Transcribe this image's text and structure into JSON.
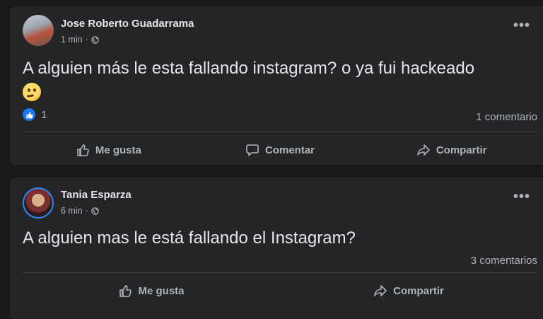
{
  "posts": [
    {
      "author": "Jose Roberto Guadarrama",
      "time": "1 min",
      "privacy_icon": "globe-icon",
      "text": "A alguien más le esta fallando instagram? o ya fui hackeado",
      "emoji": "thinking-face",
      "reaction_icon": "like-icon",
      "reaction_count": "1",
      "comments": "1 comentario",
      "actions": [
        "Me gusta",
        "Comentar",
        "Compartir"
      ]
    },
    {
      "author": "Tania Esparza",
      "time": "6 min",
      "privacy_icon": "globe-icon",
      "text": "A alguien mas le está fallando el Instagram?",
      "comments": "3 comentarios",
      "actions": [
        "Me gusta",
        "Compartir"
      ]
    }
  ],
  "colors": {
    "background": "#18191a",
    "card": "#242526",
    "text_primary": "#e4e6eb",
    "text_secondary": "#b0b3b8",
    "accent": "#1877f2"
  }
}
